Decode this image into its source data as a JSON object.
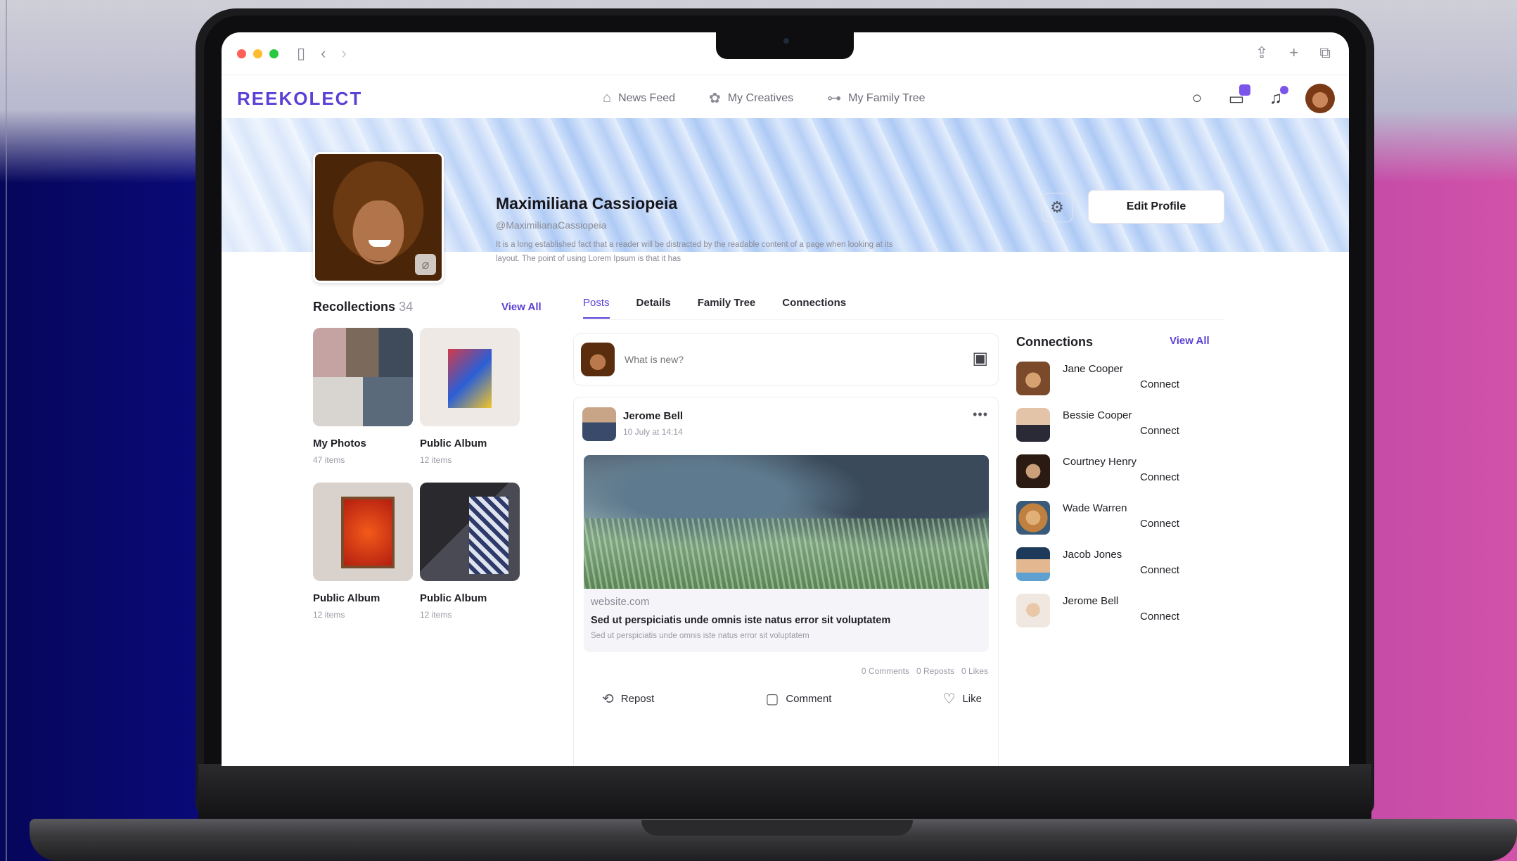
{
  "app": {
    "logo": "REEKOLECT",
    "nav": [
      {
        "label": "News Feed",
        "icon": "home-icon"
      },
      {
        "label": "My Creatives",
        "icon": "creatives-icon"
      },
      {
        "label": "My Family Tree",
        "icon": "family-tree-icon"
      }
    ],
    "nav_right": [
      "search-icon",
      "chat-icon",
      "bell-icon",
      "avatar"
    ]
  },
  "profile": {
    "name": "Maximiliana Cassiopeia",
    "handle": "@MaximilianaCassiopeia",
    "bio": "It is a long established fact that a reader will be distracted by the readable content of a page when looking at its layout. The point of using Lorem Ipsum is that it has",
    "edit_label": "Edit Profile"
  },
  "recollections": {
    "title": "Recollections",
    "count": "34",
    "view_all": "View All",
    "albums": [
      {
        "name": "My Photos",
        "count": "47 items"
      },
      {
        "name": "Public Album",
        "count": "12 items"
      },
      {
        "name": "Public Album",
        "count": "12 items"
      },
      {
        "name": "Public Album",
        "count": "12 items"
      }
    ]
  },
  "tabs": [
    {
      "label": "Posts",
      "active": true
    },
    {
      "label": "Details",
      "active": false
    },
    {
      "label": "Family Tree",
      "active": false
    },
    {
      "label": "Connections",
      "active": false
    }
  ],
  "composer": {
    "placeholder": "What is new?"
  },
  "post": {
    "author": "Jerome Bell",
    "time": "10 July at 14:14",
    "link_domain": "website.com",
    "link_title": "Sed ut perspiciatis unde omnis iste natus error sit voluptatem",
    "link_desc": "Sed ut perspiciatis unde omnis iste natus error sit voluptatem",
    "stats": {
      "comments": "0 Comments",
      "reposts": "0 Reposts",
      "likes": "0 Likes"
    },
    "actions": {
      "repost": "Repost",
      "comment": "Comment",
      "like": "Like"
    }
  },
  "connections": {
    "title": "Connections",
    "view_all": "View All",
    "connect_label": "Connect",
    "people": [
      {
        "name": "Jane Cooper"
      },
      {
        "name": "Bessie Cooper"
      },
      {
        "name": "Courtney Henry"
      },
      {
        "name": "Wade Warren"
      },
      {
        "name": "Jacob Jones"
      },
      {
        "name": "Jerome Bell"
      }
    ]
  },
  "colors": {
    "accent": "#5b3fd6",
    "badge": "#7b55ea"
  }
}
